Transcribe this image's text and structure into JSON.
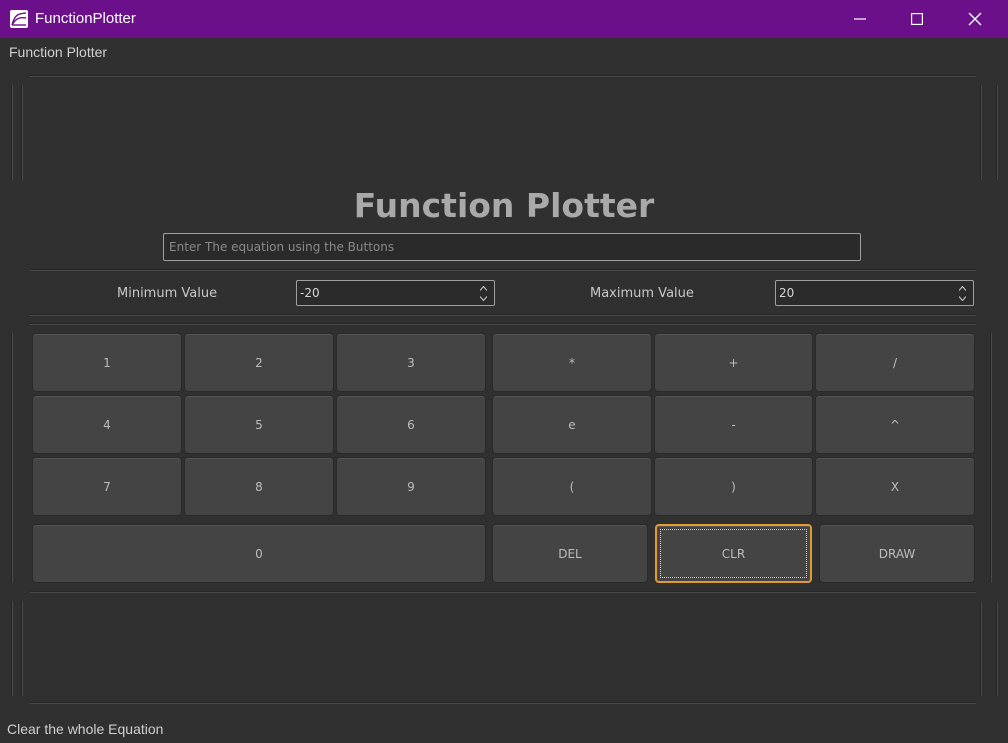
{
  "window": {
    "title": "FunctionPlotter",
    "minimize_icon": "minimize-icon",
    "maximize_icon": "maximize-icon",
    "close_icon": "close-icon"
  },
  "menu": {
    "items": [
      "Function Plotter"
    ]
  },
  "main": {
    "heading": "Function Plotter",
    "equation_placeholder": "Enter The equation using the Buttons",
    "equation_value": ""
  },
  "range": {
    "min_label": "Minimum Value",
    "min_value": "-20",
    "max_label": "Maximum Value",
    "max_value": "20"
  },
  "keypad": {
    "digits": [
      "1",
      "2",
      "3",
      "4",
      "5",
      "6",
      "7",
      "8",
      "9",
      "0"
    ],
    "operators": [
      "*",
      "+",
      "/",
      "e",
      "-",
      "^",
      "(",
      ")",
      "X"
    ],
    "actions": {
      "del": "DEL",
      "clr": "CLR",
      "draw": "DRAW"
    }
  },
  "status": {
    "text": "Clear the whole Equation"
  },
  "colors": {
    "titlebar": "#6c0f8a",
    "background": "#303030",
    "focus": "#e39a2e"
  }
}
